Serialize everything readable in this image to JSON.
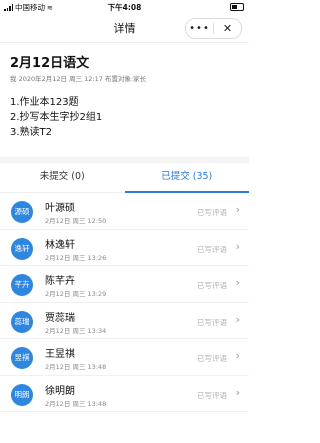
{
  "statusbar": {
    "carrier": "中国移动",
    "time": "下午4:08"
  },
  "nav": {
    "title": "详情",
    "more": "•••",
    "close": "✕"
  },
  "homework": {
    "title": "2月12日语文",
    "meta": "我 2020年2月12日 周三 12:17  布置对象:家长",
    "tasks": [
      "1.作业本123题",
      "2.抄写本生字抄2组1",
      "3.熟读T2"
    ]
  },
  "tabs": {
    "not_submitted": "未提交 (0)",
    "submitted": "已提交 (35)"
  },
  "students": [
    {
      "avatar": "源硕",
      "name": "叶源硕",
      "time": "2月12日 周三 12:50",
      "status": "已写评语"
    },
    {
      "avatar": "逸轩",
      "name": "林逸轩",
      "time": "2月12日 周三 13:26",
      "status": "已写评语"
    },
    {
      "avatar": "芊卉",
      "name": "陈芊卉",
      "time": "2月12日 周三 13:29",
      "status": "已写评语"
    },
    {
      "avatar": "蕊瑞",
      "name": "贾蕊瑞",
      "time": "2月12日 周三 13:34",
      "status": "已写评语"
    },
    {
      "avatar": "昱祺",
      "name": "王昱祺",
      "time": "2月12日 周三 13:48",
      "status": "已写评语"
    },
    {
      "avatar": "明朗",
      "name": "徐明朗",
      "time": "2月12日 周三 13:48",
      "status": "已写评语"
    }
  ],
  "colors": {
    "accent": "#2c7bd6",
    "avatar_bg": "#2f86de"
  }
}
